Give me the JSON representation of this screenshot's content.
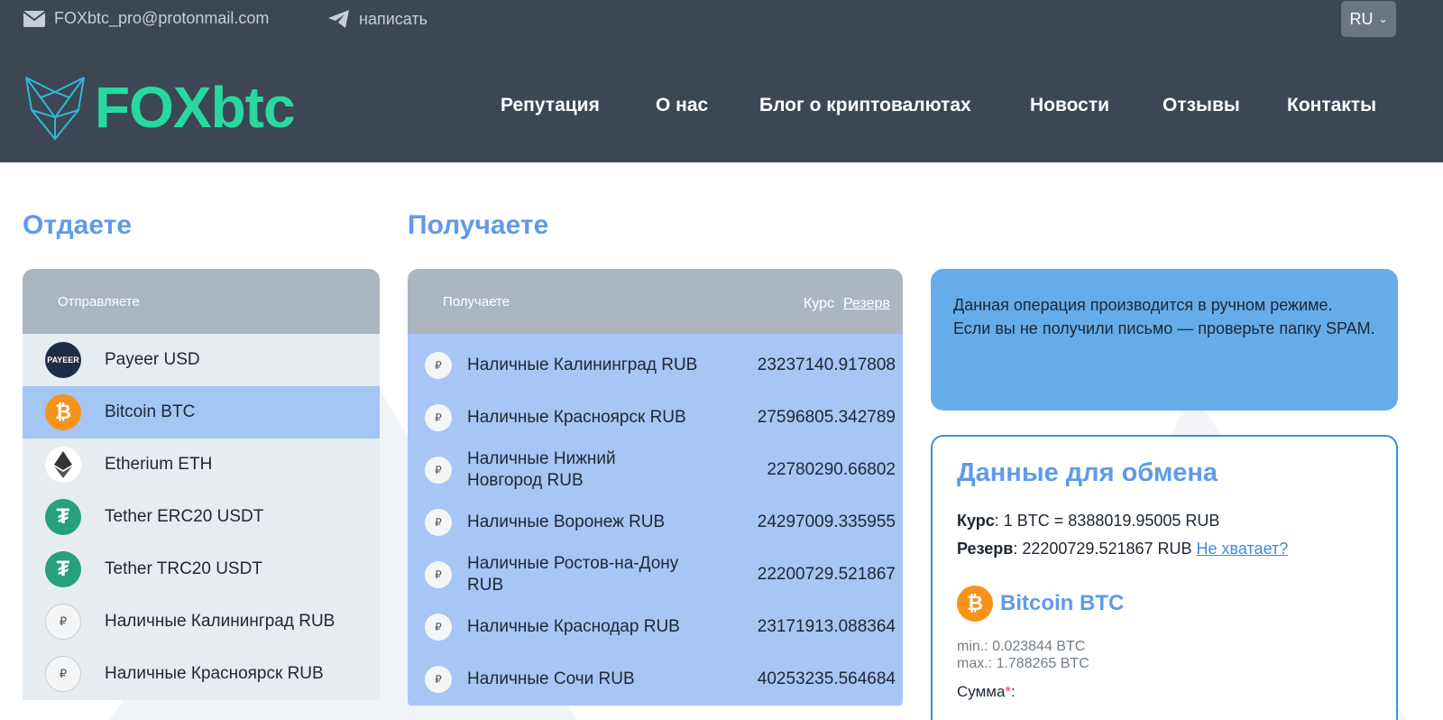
{
  "topbar": {
    "email": "FOXbtc_pro@protonmail.com",
    "write_label": "написать",
    "lang": "RU"
  },
  "logo": {
    "text": "FOXbtc"
  },
  "nav": [
    {
      "label": "Репутация"
    },
    {
      "label": "О нас"
    },
    {
      "label": "Блог о криптовалютах"
    },
    {
      "label": "Новости"
    },
    {
      "label": "Отзывы"
    },
    {
      "label": "Контакты"
    }
  ],
  "give": {
    "title": "Отдаете",
    "header": "Отправляете",
    "items": [
      {
        "label": "Payeer USD",
        "icon": "payeer-icon",
        "icon_text": "PAYEER",
        "color": "#1e2d45"
      },
      {
        "label": "Bitcoin BTC",
        "icon": "bitcoin-icon",
        "icon_text": "₿",
        "color": "#f7931a",
        "active": true
      },
      {
        "label": "Etherium ETH",
        "icon": "ethereum-icon",
        "icon_text": "◆",
        "color": "#ffffff"
      },
      {
        "label": "Tether ERC20 USDT",
        "icon": "tether-icon",
        "icon_text": "₮",
        "color": "#26a17b"
      },
      {
        "label": "Tether TRC20 USDT",
        "icon": "tether-icon",
        "icon_text": "₮",
        "color": "#26a17b"
      },
      {
        "label": "Наличные Калининград RUB",
        "icon": "cash-icon",
        "icon_text": "₽",
        "color": "#f4f5f6"
      },
      {
        "label": "Наличные Красноярск RUB",
        "icon": "cash-icon",
        "icon_text": "₽",
        "color": "#f4f5f6"
      }
    ]
  },
  "get": {
    "title": "Получаете",
    "header": "Получаете",
    "rate_label": "Курс",
    "reserve_label": "Резерв",
    "items": [
      {
        "label": "Наличные Калининград RUB",
        "reserve": "23237140.917808"
      },
      {
        "label": "Наличные Красноярск RUB",
        "reserve": "27596805.342789"
      },
      {
        "label": "Наличные Нижний Новгород RUB",
        "reserve": "22780290.66802"
      },
      {
        "label": "Наличные Воронеж RUB",
        "reserve": "24297009.335955"
      },
      {
        "label": "Наличные Ростов-на-Дону RUB",
        "reserve": "22200729.521867"
      },
      {
        "label": "Наличные Краснодар RUB",
        "reserve": "23171913.088364"
      },
      {
        "label": "Наличные Сочи RUB",
        "reserve": "40253235.564684"
      }
    ]
  },
  "info": {
    "line1": "Данная операция производится в ручном режиме.",
    "line2": "Если вы не получили письмо — проверьте папку SPAM."
  },
  "exchange": {
    "title": "Данные для обмена",
    "rate_label": "Курс",
    "rate_value": ": 1 BTC = 8388019.95005 RUB",
    "reserve_label": "Резерв",
    "reserve_value": ": 22200729.521867 RUB ",
    "reserve_link": "Не хватает?",
    "coin_label": "Bitcoin BTC",
    "min": "min.: 0.023844 BTC",
    "max": "max.: 1.788265 BTC",
    "sum_label": "Сумма",
    "sum_req": "*",
    "sum_colon": ":"
  },
  "colors": {
    "header_bg": "#3c4753",
    "accent_green": "#27d99e",
    "accent_blue": "#5e9be8",
    "active_row": "#a4c6f4"
  }
}
